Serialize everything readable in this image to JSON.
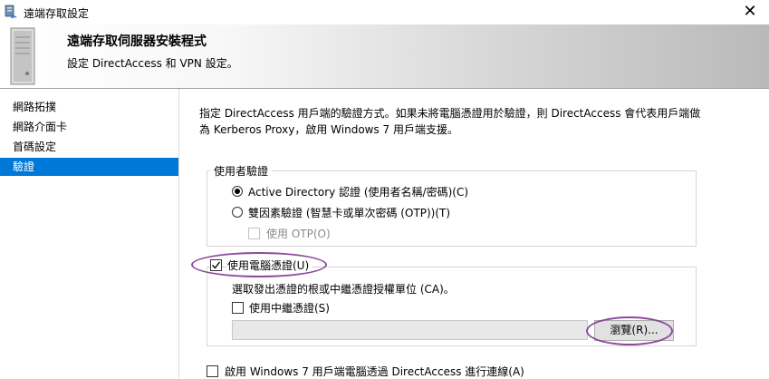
{
  "window": {
    "title": "遠端存取設定",
    "close_glyph": "✕",
    "app_icon": "remote-access-icon"
  },
  "header": {
    "title": "遠端存取伺服器安裝程式",
    "subtitle": "設定 DirectAccess 和 VPN 設定。",
    "icon": "server-icon"
  },
  "sidebar": {
    "items": [
      {
        "label": "網路拓撲",
        "selected": false
      },
      {
        "label": "網路介面卡",
        "selected": false
      },
      {
        "label": "首碼設定",
        "selected": false
      },
      {
        "label": "驗證",
        "selected": true
      }
    ]
  },
  "main": {
    "description_line1": "指定 DirectAccess 用戶端的驗證方式。如果未將電腦憑證用於驗證，則 DirectAccess 會代表用戶端做",
    "description_line2": "為 Kerberos Proxy，啟用 Windows 7 用戶端支援。",
    "user_auth": {
      "legend": "使用者驗證",
      "option_ad": "Active Directory 認證 (使用者名稱/密碼)(C)",
      "option_ad_selected": true,
      "option_2fa": "雙因素驗證 (智慧卡或單次密碼 (OTP))(T)",
      "option_2fa_selected": false,
      "use_otp": "使用 OTP(O)",
      "use_otp_checked": false,
      "use_otp_enabled": false
    },
    "computer_cert": {
      "label": "使用電腦憑證(U)",
      "checked": true,
      "instruction": "選取發出憑證的根或中繼憑證授權單位 (CA)。",
      "intermediate_label": "使用中繼憑證(S)",
      "intermediate_checked": false,
      "cert_value": "",
      "browse_label": "瀏覽(R)..."
    },
    "win7": {
      "label": "啟用 Windows 7 用戶端電腦透過 DirectAccess 進行連線(A)",
      "checked": false
    }
  },
  "colors": {
    "selection": "#0078d7",
    "annotation": "#8d4a9b"
  }
}
